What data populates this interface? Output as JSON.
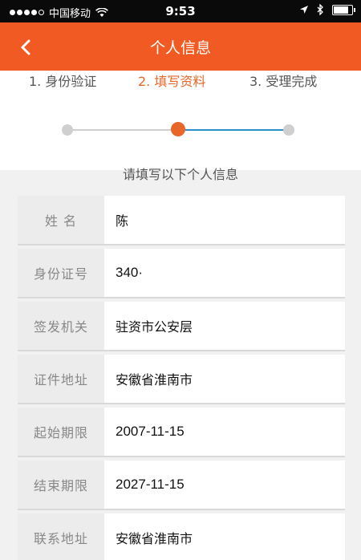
{
  "status_bar": {
    "carrier": "中国移动",
    "time": "9:53",
    "battery_level": 0.85
  },
  "nav": {
    "back_glyph": "‹",
    "title": "个人信息"
  },
  "steps": [
    {
      "label": "1. 身份验证",
      "state": "done"
    },
    {
      "label": "2. 填写资料",
      "state": "active"
    },
    {
      "label": "3. 受理完成",
      "state": "pending"
    }
  ],
  "instruction": "请填写以下个人信息",
  "form": {
    "rows": [
      {
        "label": "姓 名",
        "value": "陈"
      },
      {
        "label": "身份证号",
        "value": "340·"
      },
      {
        "label": "签发机关",
        "value": "驻资市公安层"
      },
      {
        "label": "证件地址",
        "value": "安徽省淮南市"
      },
      {
        "label": "起始期限",
        "value": "2007-11-15"
      },
      {
        "label": "结束期限",
        "value": "2027-11-15"
      },
      {
        "label": "联系地址",
        "value": "安徽省淮南市"
      }
    ]
  },
  "colors": {
    "accent": "#f15a22",
    "active_step": "#e8662a",
    "progress_blue": "#2b8ed0"
  }
}
